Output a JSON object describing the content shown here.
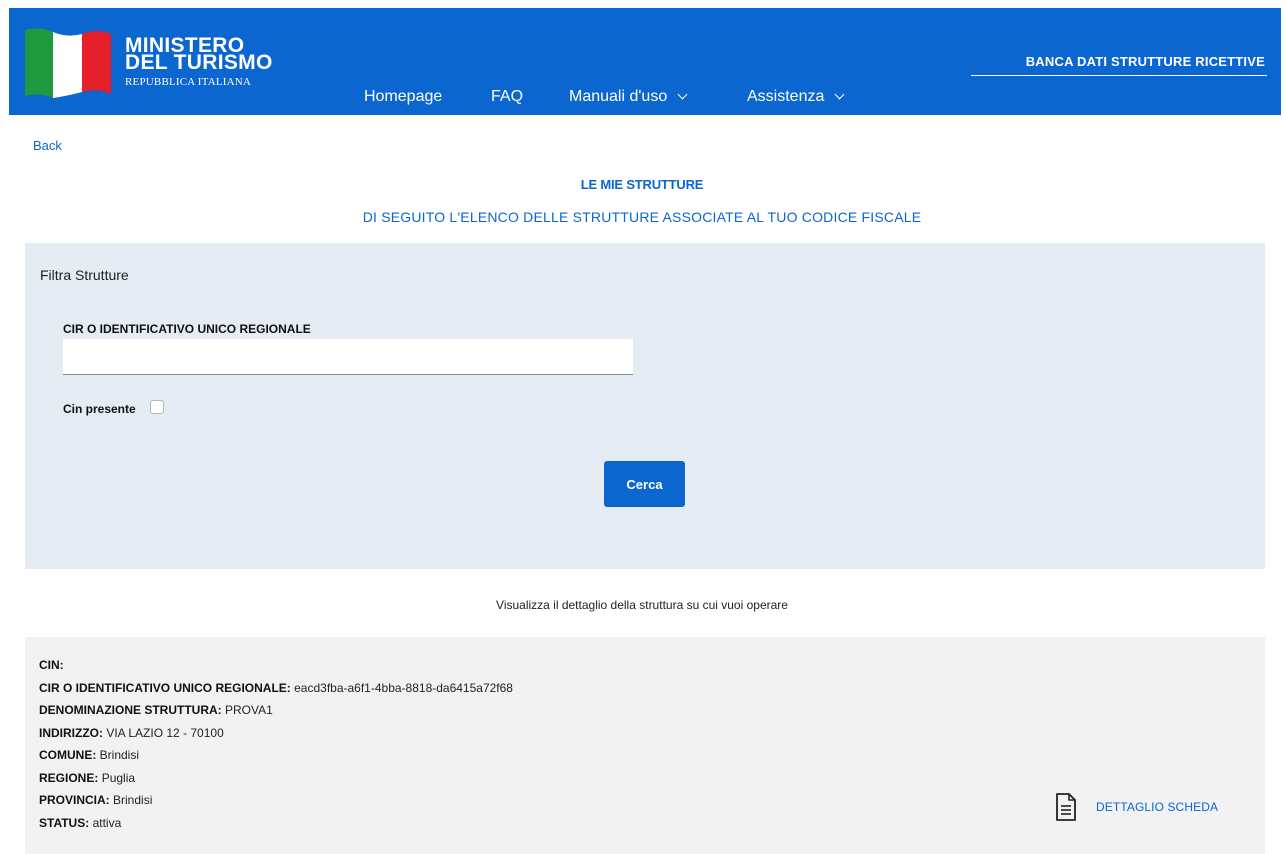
{
  "header": {
    "brand_line1": "MINISTERO",
    "brand_line2": "DEL TURISMO",
    "brand_sub": "REPUBBLICA ITALIANA",
    "nav": [
      {
        "label": "Homepage"
      },
      {
        "label": "FAQ"
      },
      {
        "label": "Manuali d'uso",
        "has_dropdown": true
      },
      {
        "label": "Assistenza",
        "has_dropdown": true
      }
    ],
    "right_title": "BANCA DATI STRUTTURE RICETTIVE",
    "accent": "#0b66cf"
  },
  "back_label": "Back",
  "page_title": "LE MIE STRUTTURE",
  "page_subtitle": "DI SEGUITO L'ELENCO DELLE STRUTTURE ASSOCIATE AL TUO CODICE FISCALE",
  "filter": {
    "title": "Filtra Strutture",
    "cir_label": "CIR O IDENTIFICATIVO UNICO REGIONALE",
    "cir_value": "",
    "cin_label": "Cin presente",
    "cin_checked": false,
    "search_label": "Cerca"
  },
  "instruction": "Visualizza il dettaglio della struttura su cui vuoi operare",
  "structure": {
    "fields": [
      {
        "label": "CIN:",
        "value": ""
      },
      {
        "label": "CIR O IDENTIFICATIVO UNICO REGIONALE:",
        "value": "eacd3fba-a6f1-4bba-8818-da6415a72f68"
      },
      {
        "label": "DENOMINAZIONE STRUTTURA:",
        "value": "PROVA1"
      },
      {
        "label": "INDIRIZZO:",
        "value": "VIA LAZIO 12 - 70100"
      },
      {
        "label": "COMUNE:",
        "value": "Brindisi"
      },
      {
        "label": "REGIONE:",
        "value": "Puglia"
      },
      {
        "label": "PROVINCIA:",
        "value": "Brindisi"
      },
      {
        "label": "STATUS:",
        "value": "attiva"
      }
    ],
    "detail_label": "DETTAGLIO SCHEDA",
    "detail_icon": "document-icon"
  }
}
